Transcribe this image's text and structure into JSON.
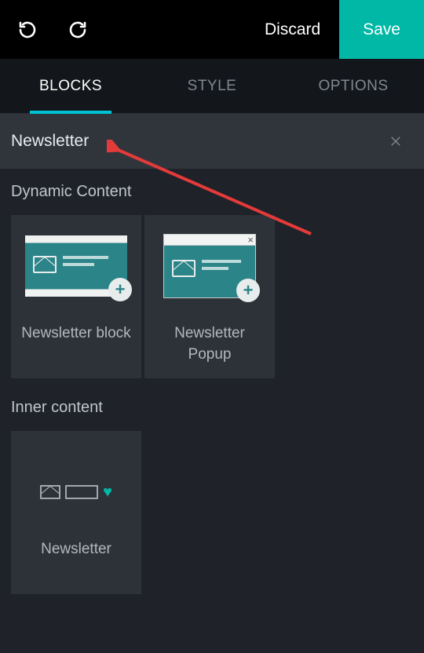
{
  "topbar": {
    "discard_label": "Discard",
    "save_label": "Save"
  },
  "tabs": {
    "blocks_label": "BLOCKS",
    "style_label": "STYLE",
    "options_label": "OPTIONS"
  },
  "search": {
    "value": "Newsletter"
  },
  "sections": {
    "dynamic_title": "Dynamic Content",
    "inner_title": "Inner content"
  },
  "blocks": {
    "newsletter_block_label": "Newsletter block",
    "newsletter_popup_label": "Newsletter Popup",
    "newsletter_inner_label": "Newsletter"
  },
  "colors": {
    "accent": "#00b8a5",
    "tab_underline": "#00c4d6"
  }
}
